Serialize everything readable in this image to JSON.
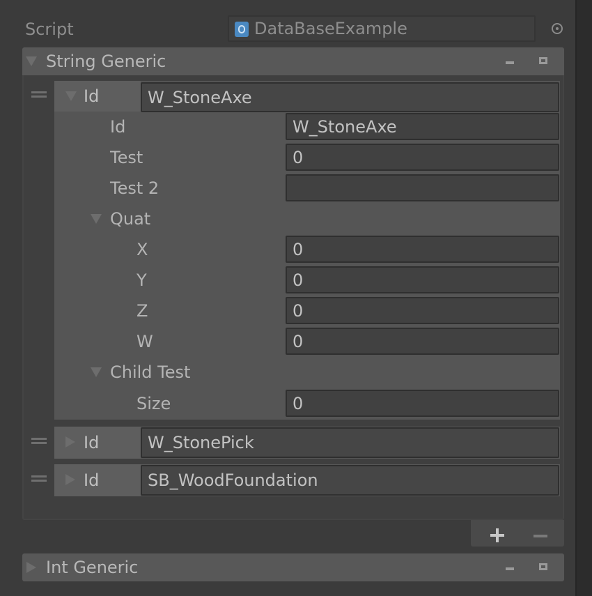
{
  "script_row": {
    "label": "Script",
    "value": "DataBaseExample",
    "script_icon": "csharp-script-icon",
    "picker_icon": "object-picker-icon"
  },
  "string_generic": {
    "title": "String Generic",
    "elements": [
      {
        "key_label": "Id",
        "key_value": "W_StoneAxe",
        "expanded": true,
        "fields": {
          "id_label": "Id",
          "id_value": "W_StoneAxe",
          "test_label": "Test",
          "test_value": "0",
          "test2_label": "Test 2",
          "test2_value": "",
          "quat_label": "Quat",
          "x_label": "X",
          "x_value": "0",
          "y_label": "Y",
          "y_value": "0",
          "z_label": "Z",
          "z_value": "0",
          "w_label": "W",
          "w_value": "0",
          "child_label": "Child Test",
          "size_label": "Size",
          "size_value": "0"
        }
      },
      {
        "key_label": "Id",
        "key_value": "W_StonePick",
        "expanded": false
      },
      {
        "key_label": "Id",
        "key_value": "SB_WoodFoundation",
        "expanded": false
      }
    ],
    "footer": {
      "add_symbol": "+",
      "remove_symbol": "−"
    }
  },
  "int_generic": {
    "title": "Int Generic",
    "expanded": false
  },
  "colors": {
    "background": "#3b3b3b",
    "field": "#414141",
    "header": "#585858",
    "text": "#b4b4b4"
  }
}
